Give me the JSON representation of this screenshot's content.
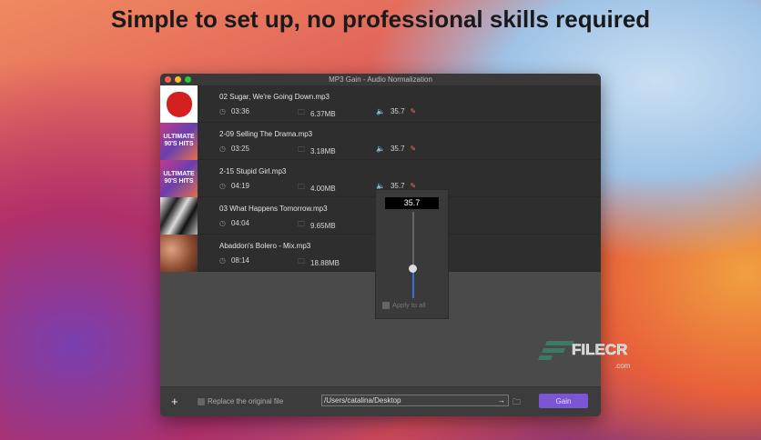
{
  "headline": "Simple to set up, no professional skills required",
  "window": {
    "title": "MP3 Gain - Audio Normalization"
  },
  "tracks": [
    {
      "name": "02 Sugar, We're Going Down.mp3",
      "duration": "03:36",
      "size": "6.37MB",
      "gain": "35.7"
    },
    {
      "name": "2-09 Selling The Drama.mp3",
      "duration": "03:25",
      "size": "3.18MB",
      "gain": "35.7"
    },
    {
      "name": "2-15 Stupid Girl.mp3",
      "duration": "04:19",
      "size": "4.00MB",
      "gain": "35.7"
    },
    {
      "name": "03 What Happens Tomorrow.mp3",
      "duration": "04:04",
      "size": "9.65MB"
    },
    {
      "name": "Abaddon's Bolero - Mix.mp3",
      "duration": "08:14",
      "size": "18.88MB"
    }
  ],
  "album_art": {
    "ultimate": "ULTIMATE",
    "hits": "90'S HITS"
  },
  "popover": {
    "value": "35.7",
    "slider_fraction": 0.35,
    "apply_label": "Apply to all"
  },
  "bottom": {
    "add": "+",
    "replace_label": "Replace the original file",
    "path": "/Users/catalina/Desktop",
    "gain_button": "Gain"
  },
  "watermark": {
    "brand": "FILECR",
    "domain": ".com"
  },
  "colors": {
    "accent": "#7b55d4",
    "slider": "#3d6ed8",
    "edit": "#e07a5f"
  }
}
